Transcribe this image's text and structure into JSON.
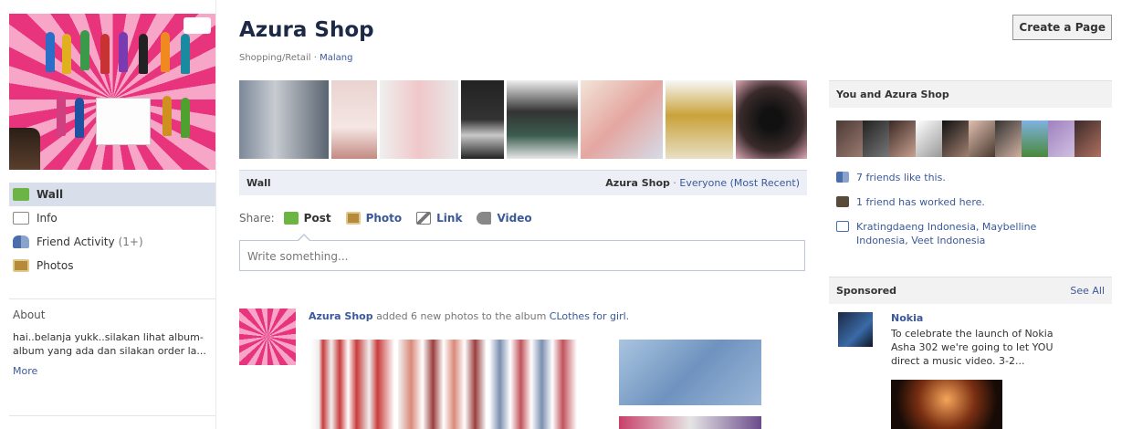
{
  "page": {
    "title": "Azura Shop",
    "category": "Shopping/Retail",
    "category_sep": " · ",
    "location": "Malang"
  },
  "left_nav": {
    "items": [
      {
        "label": "Wall",
        "icon": "wall-icon"
      },
      {
        "label": "Info",
        "icon": "info-icon"
      },
      {
        "label": "Friend Activity",
        "icon": "friends-icon",
        "count": "(1+)"
      },
      {
        "label": "Photos",
        "icon": "photos-icon"
      }
    ]
  },
  "about": {
    "heading": "About",
    "text": "hai..belanja yukk..silakan lihat album-album yang ada dan silakan order la...",
    "more": "More"
  },
  "wall": {
    "title": "Wall",
    "filter_owner": "Azura Shop",
    "filter_sep": " · ",
    "filter_text": "Everyone (Most Recent)"
  },
  "share": {
    "label": "Share:",
    "post": "Post",
    "photo": "Photo",
    "link": "Link",
    "video": "Video"
  },
  "status": {
    "placeholder": "Write something..."
  },
  "story": {
    "actor": "Azura Shop",
    "text": " added 6 new photos to the album ",
    "album": "CLothes for girl."
  },
  "right": {
    "create_page": "Create a Page",
    "you_and": "You and Azura Shop",
    "friends_like": "7 friends like this.",
    "friend_worked": "1 friend has worked here.",
    "likes_list": "Kratingdaeng Indonesia, Maybelline Indonesia, Veet Indonesia",
    "sponsored": "Sponsored",
    "see_all": "See All",
    "ad_title": "Nokia",
    "ad_body": "To celebrate the launch of Nokia Asha 302 we're going to let YOU direct a music video. 3-2..."
  },
  "colors": {
    "link": "#3b5998",
    "header_bg": "#eceff5",
    "brand_pink": "#e8337d"
  }
}
